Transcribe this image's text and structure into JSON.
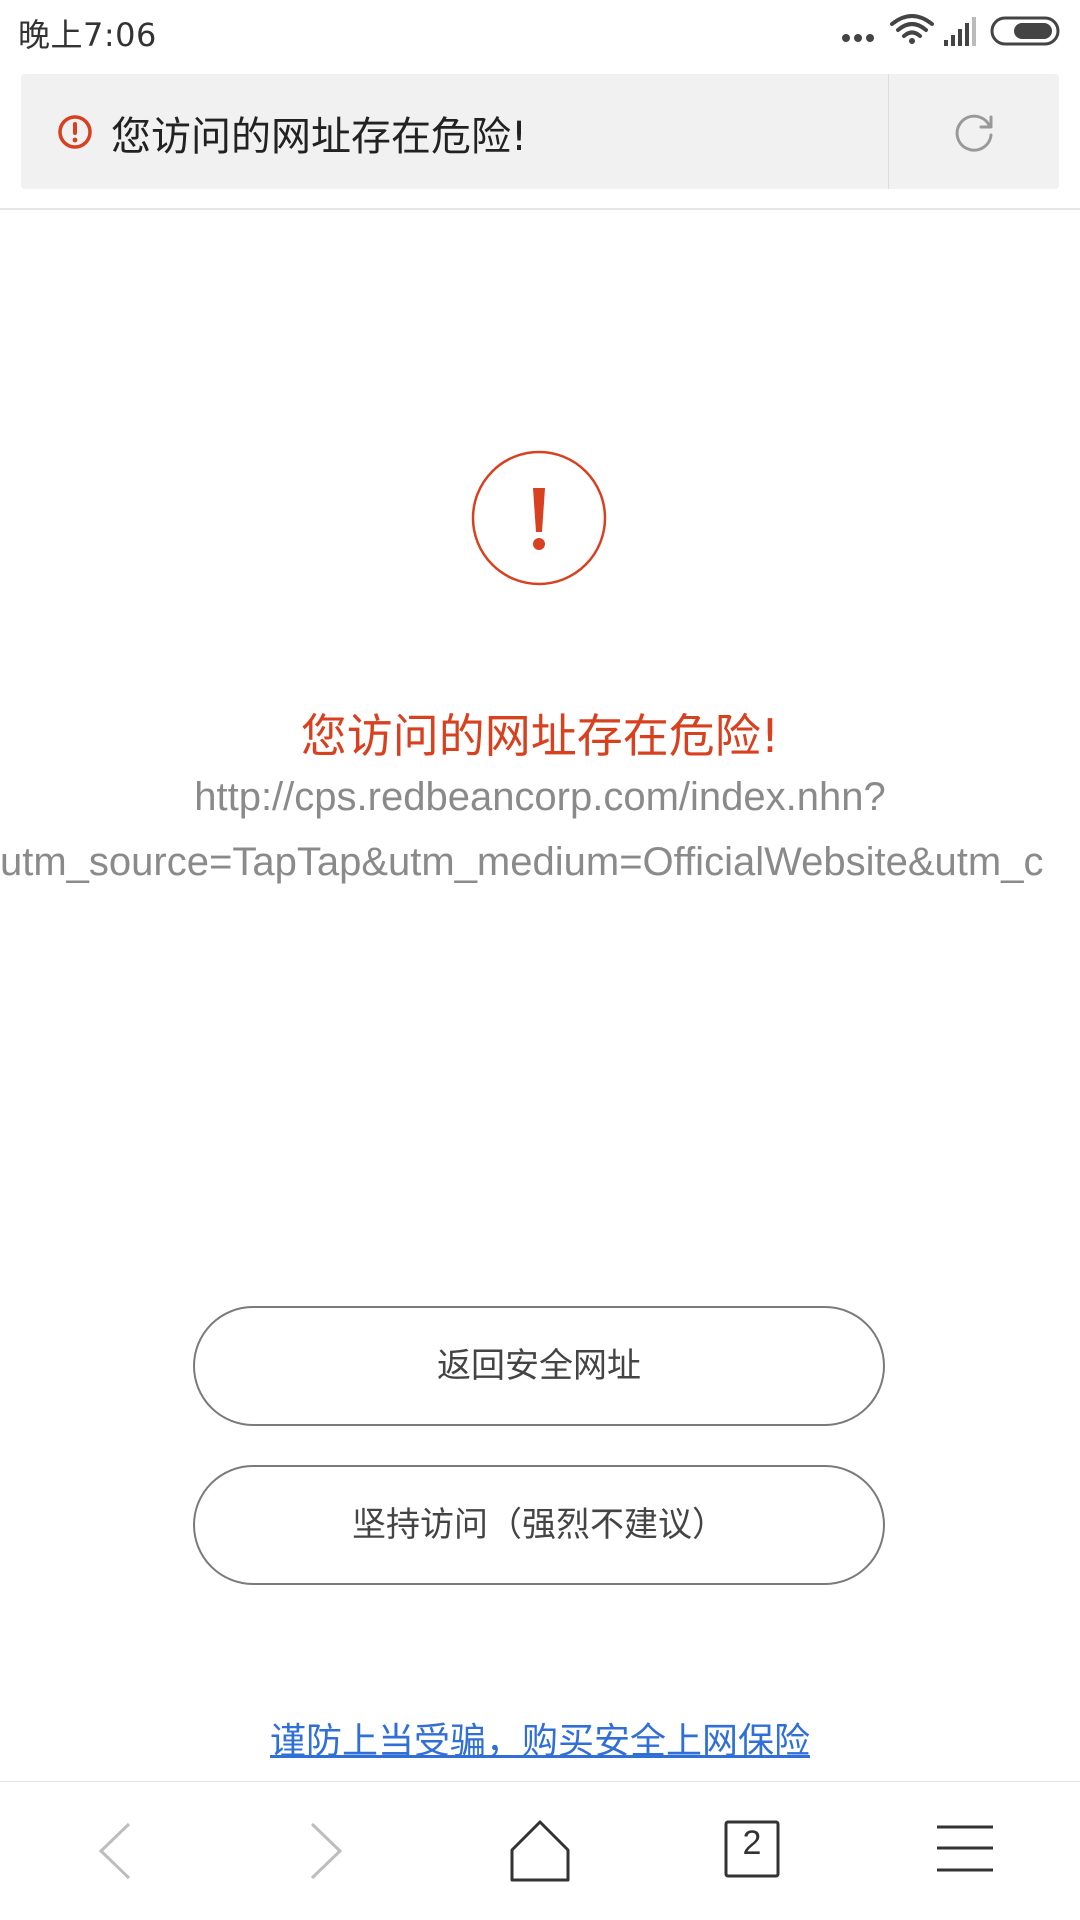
{
  "status_bar": {
    "time": "晚上7:06"
  },
  "address_bar": {
    "warning_text": "您访问的网址存在危险!",
    "warning_icon": "alert-circle-icon",
    "reload_icon": "reload-icon"
  },
  "warning": {
    "icon": "exclamation-circle-icon",
    "title": "您访问的网址存在危险!",
    "url_line1": "http://cps.redbeancorp.com/index.nhn?",
    "url_line2": "utm_source=TapTap&utm_medium=OfficialWebsite&utm_c"
  },
  "buttons": {
    "back_label": "返回安全网址",
    "continue_label": "坚持访问（强烈不建议）"
  },
  "insurance_link": "谨防上当受骗，购买安全上网保险",
  "bottom_nav": {
    "tab_count": "2"
  },
  "colors": {
    "danger": "#d8411f",
    "link": "#2f6fd6",
    "button_border": "#7a7a7a",
    "address_bg": "#f1f1f1"
  }
}
